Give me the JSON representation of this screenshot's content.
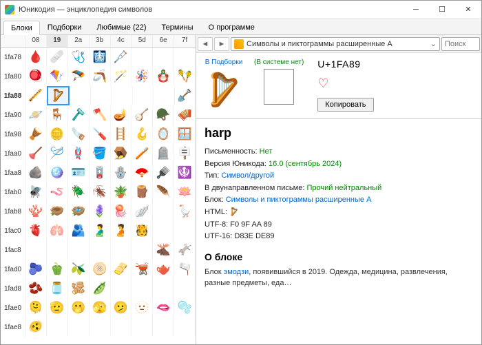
{
  "window": {
    "title": "Юникодия — энциклопедия символов"
  },
  "tabs": {
    "items": [
      "Блоки",
      "Подборки",
      "Любимые (22)",
      "Термины",
      "О программе"
    ],
    "active": 0
  },
  "cols": [
    "",
    "08",
    "19",
    "2a",
    "3b",
    "4c",
    "5d",
    "6e",
    "7f"
  ],
  "activeCol": 2,
  "rows": [
    {
      "lbl": "1fa78",
      "g": [
        "🩸",
        "🩹",
        "🩺",
        "🩻",
        "🩼",
        "",
        "",
        ""
      ]
    },
    {
      "lbl": "1fa80",
      "g": [
        "🪀",
        "🪁",
        "🪂",
        "🪃",
        "🪄",
        "🪅",
        "🪆",
        "🪇"
      ]
    },
    {
      "lbl": "1fa88",
      "bold": true,
      "g": [
        "🪈",
        "🪉",
        "",
        "",
        "",
        "",
        "",
        "🪏"
      ]
    },
    {
      "lbl": "1fa90",
      "g": [
        "🪐",
        "🪑",
        "🪒",
        "🪓",
        "🪔",
        "🪕",
        "🪖",
        "🪗"
      ]
    },
    {
      "lbl": "1fa98",
      "g": [
        "🪘",
        "🪙",
        "🪚",
        "🪛",
        "🪜",
        "🪝",
        "🪞",
        "🪟"
      ]
    },
    {
      "lbl": "1faa0",
      "g": [
        "🪠",
        "🪡",
        "🪢",
        "🪣",
        "🪤",
        "🪥",
        "🪦",
        "🪧"
      ]
    },
    {
      "lbl": "1faa8",
      "g": [
        "🪨",
        "🪩",
        "🪪",
        "🪫",
        "🪬",
        "🪭",
        "🪮",
        "🪯"
      ]
    },
    {
      "lbl": "1fab0",
      "g": [
        "🪰",
        "🪱",
        "🪲",
        "🪳",
        "🪴",
        "🪵",
        "🪶",
        "🪷"
      ]
    },
    {
      "lbl": "1fab8",
      "g": [
        "🪸",
        "🪹",
        "🪺",
        "🪻",
        "🪼",
        "🪽",
        "",
        "🪿"
      ]
    },
    {
      "lbl": "1fac0",
      "g": [
        "🫀",
        "🫁",
        "🫂",
        "🫃",
        "🫄",
        "🫅",
        "",
        ""
      ]
    },
    {
      "lbl": "1fac8",
      "g": [
        "",
        "",
        "",
        "",
        "",
        "",
        "🫎",
        "🫏"
      ]
    },
    {
      "lbl": "1fad0",
      "g": [
        "🫐",
        "🫑",
        "🫒",
        "🫓",
        "🫔",
        "🫕",
        "🫖",
        "🫗"
      ]
    },
    {
      "lbl": "1fad8",
      "g": [
        "🫘",
        "🫙",
        "🫚",
        "🫛",
        "",
        "",
        "",
        ""
      ]
    },
    {
      "lbl": "1fae0",
      "g": [
        "🫠",
        "🫡",
        "🫢",
        "🫣",
        "🫤",
        "🫥",
        "🫦",
        "🫧"
      ]
    },
    {
      "lbl": "1fae8",
      "g": [
        "🫨",
        "",
        "",
        "",
        "",
        "",
        "",
        ""
      ]
    }
  ],
  "selRow": 2,
  "selCol": 1,
  "nav": {
    "combo": "Символы и пиктограммы расширенные A",
    "search": "Поиск"
  },
  "preview": {
    "lblCollection": "В Подборки",
    "lblSystem": "(В системе нет)",
    "glyph": "🪉",
    "codepoint": "U+1FA89",
    "copy": "Копировать"
  },
  "details": {
    "name": "harp",
    "props": [
      {
        "k": "Письменность:",
        "v": "Нет",
        "cls": "green"
      },
      {
        "k": "Версия Юникода:",
        "v": "16.0 (сентябрь 2024)",
        "cls": "green"
      },
      {
        "k": "Тип:",
        "v": "Символ/другой",
        "cls": "link"
      },
      {
        "k": "В двунаправленном письме:",
        "v": "Прочий нейтральный",
        "cls": "green"
      },
      {
        "k": "Блок:",
        "v": "Символы и пиктограммы расширенные A",
        "cls": "link"
      },
      {
        "k": "HTML:",
        "v": "&#129673;",
        "cls": ""
      },
      {
        "k": "UTF-8:",
        "v": "F0 9F AA 89",
        "cls": ""
      },
      {
        "k": "UTF-16:",
        "v": "D83E DE89",
        "cls": ""
      }
    ],
    "blockTitle": "О блоке",
    "blockText1": "Блок ",
    "blockLink": "эмодзи",
    "blockText2": ", появившийся в 2019. Одежда, медицина, развлечения, разные предметы, еда…"
  }
}
